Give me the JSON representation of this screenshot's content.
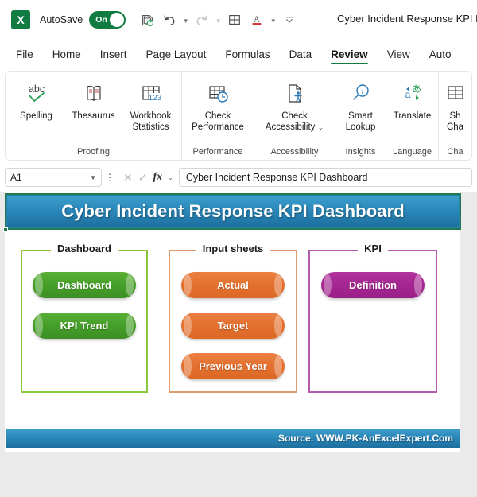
{
  "titlebar": {
    "app_icon": "excel-logo-icon",
    "app_icon_glyph": "X",
    "autosave_label": "AutoSave",
    "autosave_state": "On",
    "document_title": "Cyber Incident Response KPI Das",
    "qat": [
      {
        "name": "save-icon",
        "label": "Save"
      },
      {
        "name": "undo-icon",
        "label": "Undo"
      },
      {
        "name": "redo-icon",
        "label": "Redo"
      },
      {
        "name": "borders-icon",
        "label": "Borders"
      },
      {
        "name": "font-color-icon",
        "label": "Font Color"
      },
      {
        "name": "customize-quick-access-toolbar-icon",
        "label": "Customize Quick Access Toolbar"
      }
    ]
  },
  "ribbon": {
    "tabs": [
      {
        "label": "File",
        "active": false
      },
      {
        "label": "Home",
        "active": false
      },
      {
        "label": "Insert",
        "active": false
      },
      {
        "label": "Page Layout",
        "active": false
      },
      {
        "label": "Formulas",
        "active": false
      },
      {
        "label": "Data",
        "active": false
      },
      {
        "label": "Review",
        "active": true
      },
      {
        "label": "View",
        "active": false
      },
      {
        "label": "Auto",
        "active": false
      }
    ],
    "groups": [
      {
        "name": "Proofing",
        "items": [
          {
            "label": "Spelling",
            "icon": "spelling-abc-check-icon"
          },
          {
            "label": "Thesaurus",
            "icon": "thesaurus-book-icon"
          },
          {
            "label": "Workbook Statistics",
            "icon": "workbook-statistics-icon"
          }
        ]
      },
      {
        "name": "Performance",
        "items": [
          {
            "label": "Check Performance",
            "icon": "check-performance-icon"
          }
        ]
      },
      {
        "name": "Accessibility",
        "items": [
          {
            "label": "Check Accessibility",
            "icon": "check-accessibility-icon",
            "has_dropdown": true
          }
        ]
      },
      {
        "name": "Insights",
        "items": [
          {
            "label": "Smart Lookup",
            "icon": "smart-lookup-icon"
          }
        ]
      },
      {
        "name": "Language",
        "items": [
          {
            "label": "Translate",
            "icon": "translate-icon"
          }
        ]
      },
      {
        "name": "Cha",
        "items": [
          {
            "label": "Sh Cha",
            "icon": "show-changes-icon"
          }
        ]
      }
    ]
  },
  "formula_bar": {
    "name_box_value": "A1",
    "cancel_icon": "cancel-x-icon",
    "enter_icon": "enter-check-icon",
    "function_icon": "insert-function-fx-icon",
    "formula_value": "Cyber Incident Response KPI Dashboard"
  },
  "dashboard": {
    "title": "Cyber Incident Response KPI Dashboard",
    "footer_source": "Source: WWW.PK-AnExcelExpert.Com",
    "colors": {
      "banner_start": "#3d9ecb",
      "banner_end": "#1d6f9e",
      "green": "#46a02a",
      "orange": "#e4712f",
      "purple": "#a52792",
      "selection": "#1f7a4d"
    },
    "panels": [
      {
        "title": "Dashboard",
        "border_color": "#8cc63f",
        "buttons": [
          {
            "label": "Dashboard",
            "color": "green"
          },
          {
            "label": "KPI Trend",
            "color": "green"
          }
        ]
      },
      {
        "title": "Input sheets",
        "border_color": "#e09b6d",
        "buttons": [
          {
            "label": "Actual",
            "color": "orange"
          },
          {
            "label": "Target",
            "color": "orange"
          },
          {
            "label": "Previous Year",
            "color": "orange"
          }
        ]
      },
      {
        "title": "KPI",
        "border_color": "#b45bb0",
        "buttons": [
          {
            "label": "Definition",
            "color": "purple"
          }
        ]
      }
    ]
  }
}
